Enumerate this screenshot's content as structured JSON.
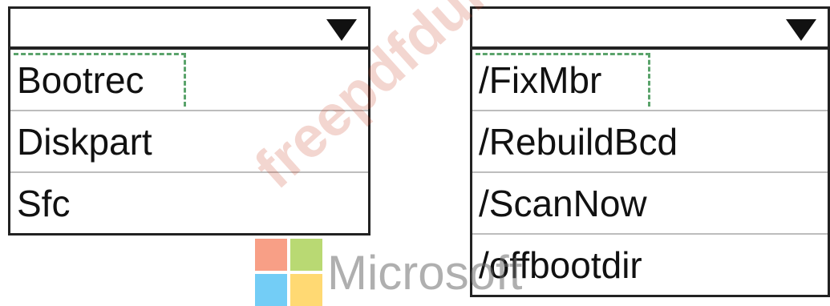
{
  "dropdowns": [
    {
      "selected": "",
      "options": [
        "Bootrec",
        "Diskpart",
        "Sfc"
      ],
      "highlighted_index": 0
    },
    {
      "selected": "",
      "options": [
        "/FixMbr",
        "/RebuildBcd",
        "/ScanNow",
        "/offbootdir"
      ],
      "highlighted_index": 0
    }
  ],
  "watermark": {
    "text": "freepdfdumps.com",
    "brand": "Microsoft"
  },
  "colors": {
    "highlight_dash": "#5aa36b",
    "ms_red": "#f25022",
    "ms_green": "#7fba00",
    "ms_blue": "#00a4ef",
    "ms_yellow": "#ffb900"
  }
}
